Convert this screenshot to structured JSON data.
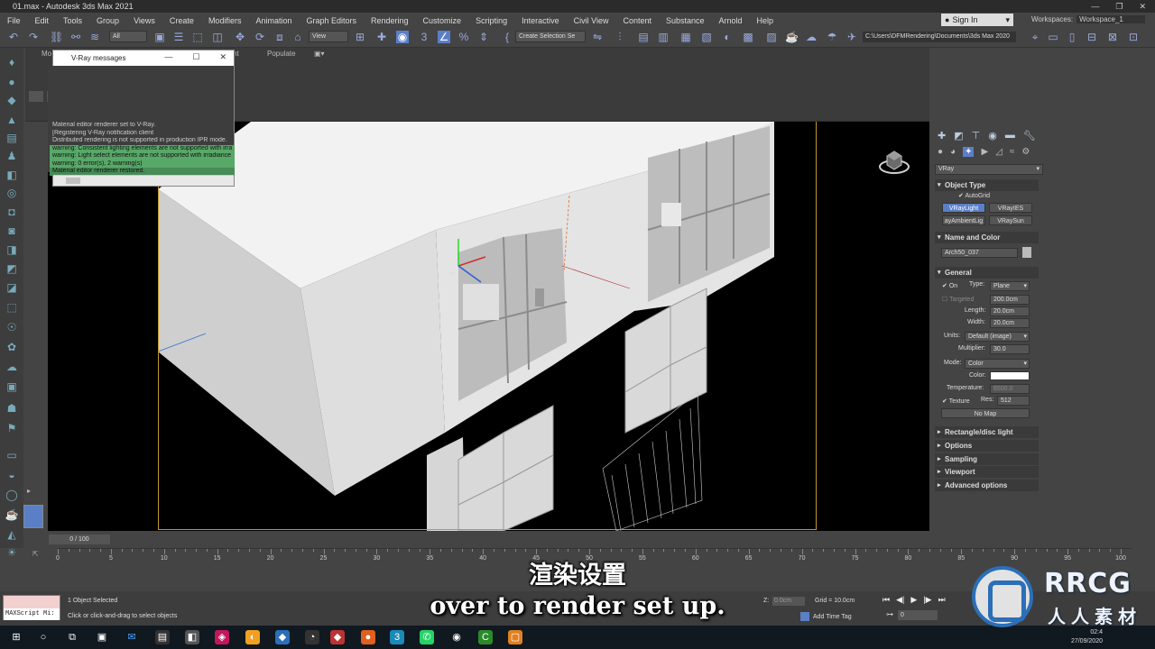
{
  "window": {
    "title": "01.max - Autodesk 3ds Max 2021",
    "controls": [
      "—",
      "❐",
      "✕"
    ]
  },
  "menubar": {
    "items": [
      "File",
      "Edit",
      "Tools",
      "Group",
      "Views",
      "Create",
      "Modifiers",
      "Animation",
      "Graph Editors",
      "Rendering",
      "Customize",
      "Scripting",
      "Interactive",
      "Civil View",
      "Content",
      "Substance",
      "Arnold",
      "Help"
    ],
    "sign_in": "Sign In",
    "workspaces_label": "Workspaces:",
    "workspace_value": "Workspace_1"
  },
  "toolbar": {
    "selection_filter": "All",
    "ref_coord": "View",
    "named_selection": "Create Selection Se",
    "project_path": "C:\\Users\\DFMRendering\\Documents\\3ds Max 2020"
  },
  "ribbon": {
    "tabs": [
      "Mo",
      "nt",
      "Populate"
    ]
  },
  "vray_messages": {
    "title": "V-Ray messages",
    "lines": [
      {
        "text": "Material editor renderer set to V-Ray.",
        "kind": "normal"
      },
      {
        "text": "[Registering V-Ray notification client",
        "kind": "normal"
      },
      {
        "text": "Distributed rendering is not supported in production IPR mode.",
        "kind": "normal"
      },
      {
        "text": "warning: Consistent lighting elements are not supported with irra",
        "kind": "warn"
      },
      {
        "text": "warning: Light select elements are not supported with irradiance",
        "kind": "warn"
      },
      {
        "text": "warning: 0 error(s), 2 warning(s)",
        "kind": "warn"
      },
      {
        "text": "Material editor renderer restored.",
        "kind": "warn2"
      }
    ]
  },
  "command_panel": {
    "renderer": "VRay",
    "object_type": {
      "title": "Object Type",
      "autogrid": "AutoGrid",
      "buttons": [
        "VRayLight",
        "VRayIES",
        "ayAmbientLig",
        "VRaySun"
      ]
    },
    "name_and_color": {
      "title": "Name and Color",
      "name": "Arch50_037"
    },
    "general": {
      "title": "General",
      "on_label": "On",
      "type_label": "Type:",
      "type_value": "Plane",
      "targeted_label": "Targeted",
      "targeted_value": "200.0cm",
      "length_label": "Length:",
      "length_value": "20.0cm",
      "width_label": "Width:",
      "width_value": "20.0cm",
      "units_label": "Units:",
      "units_value": "Default (image)",
      "multiplier_label": "Multiplier:",
      "multiplier_value": "30.0",
      "mode_label": "Mode:",
      "mode_value": "Color",
      "color_label": "Color:",
      "temperature_label": "Temperature:",
      "temperature_value": "6500.0",
      "texture_label": "Texture",
      "res_label": "Res:",
      "res_value": "512",
      "no_map": "No Map"
    },
    "rollouts": [
      "Rectangle/disc light",
      "Options",
      "Sampling",
      "Viewport",
      "Advanced options"
    ]
  },
  "timeline": {
    "slider": "0 / 100",
    "ticks": [
      "0",
      "5",
      "10",
      "15",
      "20",
      "25",
      "30",
      "35",
      "40",
      "45",
      "50",
      "55",
      "60",
      "65",
      "70",
      "75",
      "80",
      "85",
      "90",
      "95",
      "100"
    ]
  },
  "status": {
    "maxscript": "MAXScript Mi:",
    "selected": "1 Object Selected",
    "prompt": "Click or click-and-drag to select objects",
    "z_label": "Z:",
    "z_value": "0.0cm",
    "grid": "Grid = 10.0cm",
    "add_time_tag": "Add Time Tag",
    "frame": "0"
  },
  "taskbar": {
    "time": "02:4",
    "date": "27/09/2020"
  },
  "subtitles": {
    "chinese": "渲染设置",
    "english": "over to render set up."
  },
  "watermark": {
    "brand": "RRCG",
    "chinese": "人人素材"
  }
}
